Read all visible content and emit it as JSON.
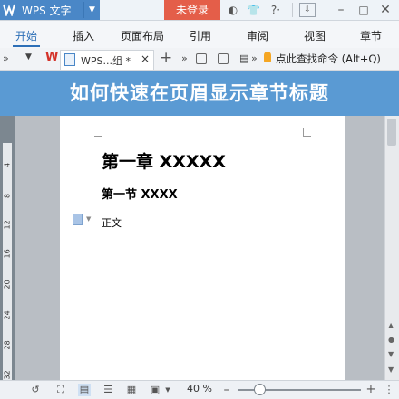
{
  "app": {
    "name": "WPS 文字",
    "login_label": "未登录"
  },
  "ribbon": {
    "tabs": [
      "开始",
      "插入",
      "页面布局",
      "引用",
      "审阅",
      "视图",
      "章节"
    ],
    "active": "开始"
  },
  "doc_tab": {
    "title": "WPS...组 *",
    "close": "×",
    "new": "+"
  },
  "search": {
    "label": "点此查找命令 (Alt+Q)"
  },
  "banner": {
    "text": "如何快速在页眉显示章节标题"
  },
  "document": {
    "heading1": "第一章  XXXXX",
    "heading2": "第一节  XXXX",
    "body": "正文"
  },
  "ruler": {
    "numbers": [
      "4",
      "8",
      "12",
      "16",
      "20",
      "24",
      "28",
      "32"
    ]
  },
  "status": {
    "zoom": "40 %"
  },
  "colors": {
    "accent": "#4a87c7",
    "login": "#e45e49",
    "banner": "#5a9ad3"
  }
}
